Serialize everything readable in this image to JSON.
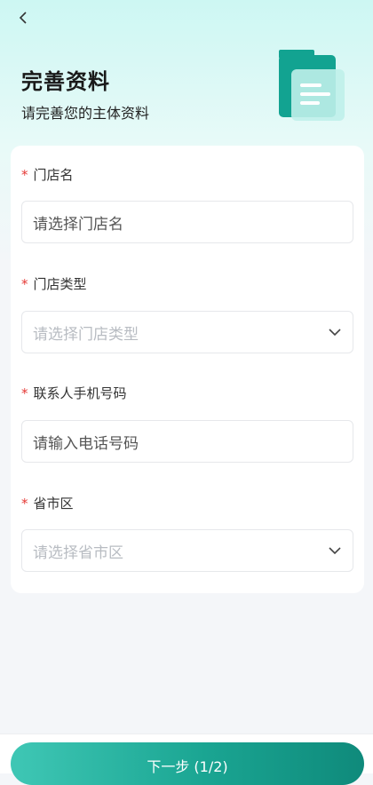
{
  "header": {
    "title": "完善资料",
    "subtitle": "请完善您的主体资料"
  },
  "form": {
    "fields": [
      {
        "label": "门店名",
        "required_mark": "*",
        "placeholder": "请选择门店名",
        "type": "text"
      },
      {
        "label": "门店类型",
        "required_mark": "*",
        "placeholder": "请选择门店类型",
        "type": "select"
      },
      {
        "label": "联系人手机号码",
        "required_mark": "*",
        "placeholder": "请输入电话号码",
        "type": "text"
      },
      {
        "label": "省市区",
        "required_mark": "*",
        "placeholder": "请选择省市区",
        "type": "select"
      }
    ]
  },
  "footer": {
    "next_label": "下一步   (1/2)"
  },
  "colors": {
    "accent": "#1aa592",
    "required": "#e53935",
    "card": "#ffffff",
    "page_bg": "#f4f6f9"
  },
  "icons": [
    "back-arrow-icon",
    "document-list-icon",
    "chevron-down-icon"
  ]
}
